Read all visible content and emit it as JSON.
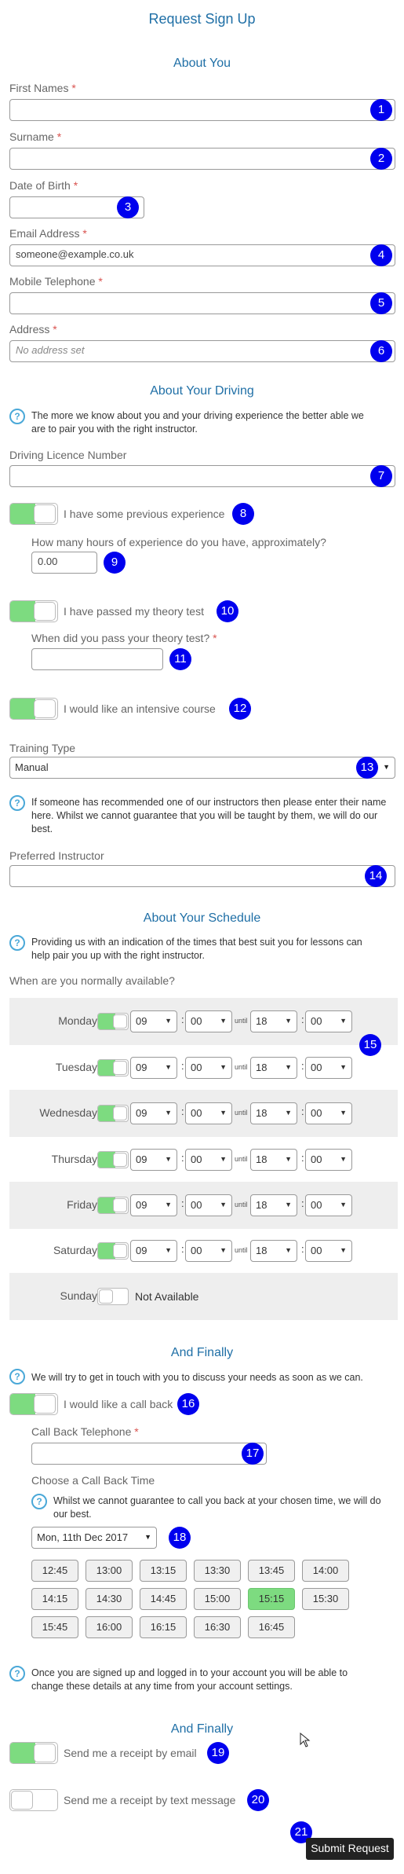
{
  "title": "Request Sign Up",
  "sections": {
    "about_you": "About You",
    "about_driving": "About Your Driving",
    "about_schedule": "About Your Schedule",
    "and_finally_1": "And Finally",
    "and_finally_2": "And Finally"
  },
  "fields": {
    "first_names": {
      "label": "First Names",
      "value": ""
    },
    "surname": {
      "label": "Surname",
      "value": ""
    },
    "dob": {
      "label": "Date of Birth",
      "value": ""
    },
    "email": {
      "label": "Email Address",
      "value": "someone@example.co.uk"
    },
    "mobile": {
      "label": "Mobile Telephone",
      "value": ""
    },
    "address": {
      "label": "Address",
      "placeholder": "No address set"
    },
    "licence": {
      "label": "Driving Licence Number",
      "value": ""
    },
    "hours": {
      "label": "How many hours of experience do you have, approximately?",
      "value": "0.00"
    },
    "theory_date": {
      "label": "When did you pass your theory test?",
      "value": ""
    },
    "training_type": {
      "label": "Training Type",
      "value": "Manual"
    },
    "preferred": {
      "label": "Preferred Instructor",
      "value": ""
    },
    "callback_phone": {
      "label": "Call Back Telephone",
      "value": ""
    }
  },
  "required_mark": "*",
  "info": {
    "driving": "The more we know about you and your driving experience the better able we are to pair you with the right instructor.",
    "recommend": "If someone has recommended one of our instructors then please enter their name here. Whilst we cannot guarantee that you will be taught by them, we will do our best.",
    "schedule": "Providing us with an indication of the times that best suit you for lessons can help pair you up with the right instructor.",
    "contact": "We will try to get in touch with you to discuss your needs as soon as we can.",
    "callback": "Whilst we cannot guarantee to call you back at your chosen time, we will do our best.",
    "settings": "Once you are signed up and logged in to your account you will be able to change these details at any time from your account settings."
  },
  "toggles": {
    "experience": {
      "label": "I have some previous experience",
      "on": true
    },
    "theory": {
      "label": "I have passed my theory test",
      "on": true
    },
    "intensive": {
      "label": "I would like an intensive course",
      "on": true
    },
    "callback": {
      "label": "I would like a call back",
      "on": true
    },
    "receipt_email": {
      "label": "Send me a receipt by email",
      "on": true
    },
    "receipt_text": {
      "label": "Send me a receipt by text message",
      "on": false
    }
  },
  "schedule": {
    "question": "When are you normally available?",
    "until": "until",
    "colon": ":",
    "days": [
      {
        "name": "Monday",
        "from_h": "09",
        "from_m": "00",
        "to_h": "18",
        "to_m": "00"
      },
      {
        "name": "Tuesday",
        "from_h": "09",
        "from_m": "00",
        "to_h": "18",
        "to_m": "00"
      },
      {
        "name": "Wednesday",
        "from_h": "09",
        "from_m": "00",
        "to_h": "18",
        "to_m": "00"
      },
      {
        "name": "Thursday",
        "from_h": "09",
        "from_m": "00",
        "to_h": "18",
        "to_m": "00"
      },
      {
        "name": "Friday",
        "from_h": "09",
        "from_m": "00",
        "to_h": "18",
        "to_m": "00"
      },
      {
        "name": "Saturday",
        "from_h": "09",
        "from_m": "00",
        "to_h": "18",
        "to_m": "00"
      }
    ],
    "sunday": {
      "name": "Sunday",
      "status": "Not Available"
    }
  },
  "callback_time": {
    "label": "Choose a Call Back Time",
    "date": "Mon, 11th Dec 2017",
    "slots": [
      "12:45",
      "13:00",
      "13:15",
      "13:30",
      "13:45",
      "14:00",
      "14:15",
      "14:30",
      "14:45",
      "15:00",
      "15:15",
      "15:30",
      "15:45",
      "16:00",
      "16:15",
      "16:30",
      "16:45"
    ],
    "selected": "15:15"
  },
  "badges": [
    "1",
    "2",
    "3",
    "4",
    "5",
    "6",
    "7",
    "8",
    "9",
    "10",
    "11",
    "12",
    "13",
    "14",
    "15",
    "16",
    "17",
    "18",
    "19",
    "20",
    "21"
  ],
  "submit": "Submit Request",
  "colors": {
    "accent": "#1f6fa6",
    "toggle_on": "#7ddb80",
    "badge": "#0000ee",
    "required": "#d9534f"
  }
}
